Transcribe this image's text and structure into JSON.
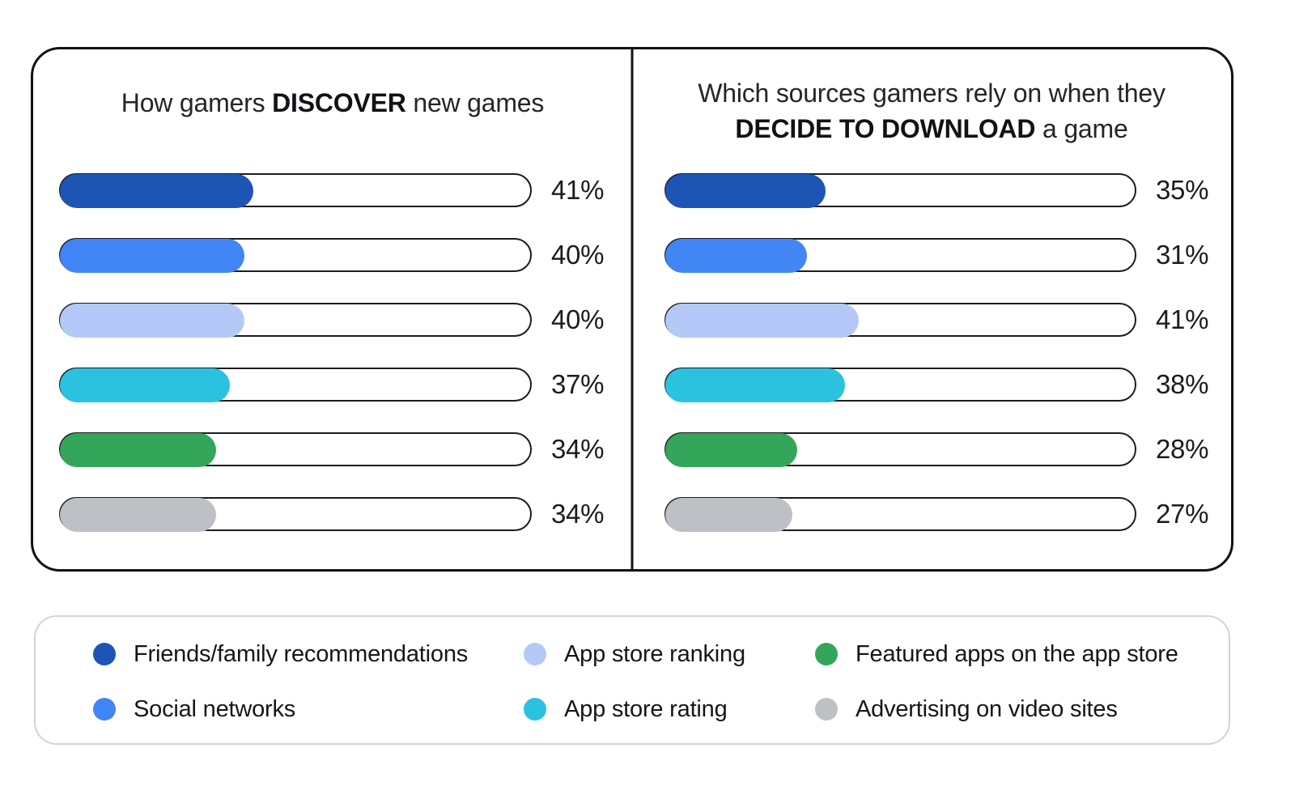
{
  "chart_data": {
    "type": "bar",
    "title": "How gamers discover new games vs. which sources they rely on when deciding to download",
    "orientation": "horizontal",
    "value_suffix": "%",
    "xlim": [
      0,
      100
    ],
    "grid": false,
    "legend_position": "bottom",
    "categories": [
      "Friends/family recommendations",
      "Social networks",
      "App store ranking",
      "App store rating",
      "Featured apps on the app store",
      "Advertising on video sites"
    ],
    "series": [
      {
        "name": "How gamers DISCOVER new games",
        "values": [
          41,
          40,
          40,
          37,
          34,
          34
        ],
        "labels": [
          "41%",
          "40%",
          "40%",
          "37%",
          "34%",
          "34%"
        ]
      },
      {
        "name": "Which sources gamers rely on when they DECIDE TO DOWNLOAD a game",
        "values": [
          35,
          31,
          41,
          38,
          28,
          27
        ],
        "labels": [
          "35%",
          "31%",
          "41%",
          "38%",
          "28%",
          "27%"
        ]
      }
    ],
    "colors": [
      "#1d55b5",
      "#4285f4",
      "#b4c9f7",
      "#2ac2de",
      "#33a65a",
      "#bdc0c5"
    ]
  },
  "panels": [
    {
      "title_prefix": "How gamers ",
      "title_bold": "DISCOVER",
      "title_suffix": " new games",
      "bars": [
        {
          "label": "Friends/family recommendations",
          "value": "41%",
          "pct": 41,
          "color": "#1d55b5"
        },
        {
          "label": "Social networks",
          "value": "40%",
          "pct": 39,
          "color": "#4285f4"
        },
        {
          "label": "App store ranking",
          "value": "40%",
          "pct": 39,
          "color": "#b4c9f7"
        },
        {
          "label": "App store rating",
          "value": "37%",
          "pct": 36,
          "color": "#2ac2de"
        },
        {
          "label": "Featured apps on the app store",
          "value": "34%",
          "pct": 33,
          "color": "#33a65a"
        },
        {
          "label": "Advertising on video sites",
          "value": "34%",
          "pct": 33,
          "color": "#bdc0c5"
        }
      ]
    },
    {
      "title_prefix": "Which sources gamers rely on when they ",
      "title_bold": "DECIDE TO DOWNLOAD",
      "title_suffix": " a game",
      "bars": [
        {
          "label": "Friends/family recommendations",
          "value": "35%",
          "pct": 34,
          "color": "#1d55b5"
        },
        {
          "label": "Social networks",
          "value": "31%",
          "pct": 30,
          "color": "#4285f4"
        },
        {
          "label": "App store ranking",
          "value": "41%",
          "pct": 41,
          "color": "#b4c9f7"
        },
        {
          "label": "App store rating",
          "value": "38%",
          "pct": 38,
          "color": "#2ac2de"
        },
        {
          "label": "Featured apps on the app store",
          "value": "28%",
          "pct": 28,
          "color": "#33a65a"
        },
        {
          "label": "Advertising on video sites",
          "value": "27%",
          "pct": 27,
          "color": "#bdc0c5"
        }
      ]
    }
  ],
  "legend": {
    "items": [
      {
        "label": "Friends/family recommendations",
        "color": "#1d55b5"
      },
      {
        "label": "Social networks",
        "color": "#4285f4"
      },
      {
        "label": "App store ranking",
        "color": "#b4c9f7"
      },
      {
        "label": "App store rating",
        "color": "#2ac2de"
      },
      {
        "label": "Featured apps on the app store",
        "color": "#33a65a"
      },
      {
        "label": "Advertising on video sites",
        "color": "#bdc0c5"
      }
    ]
  }
}
